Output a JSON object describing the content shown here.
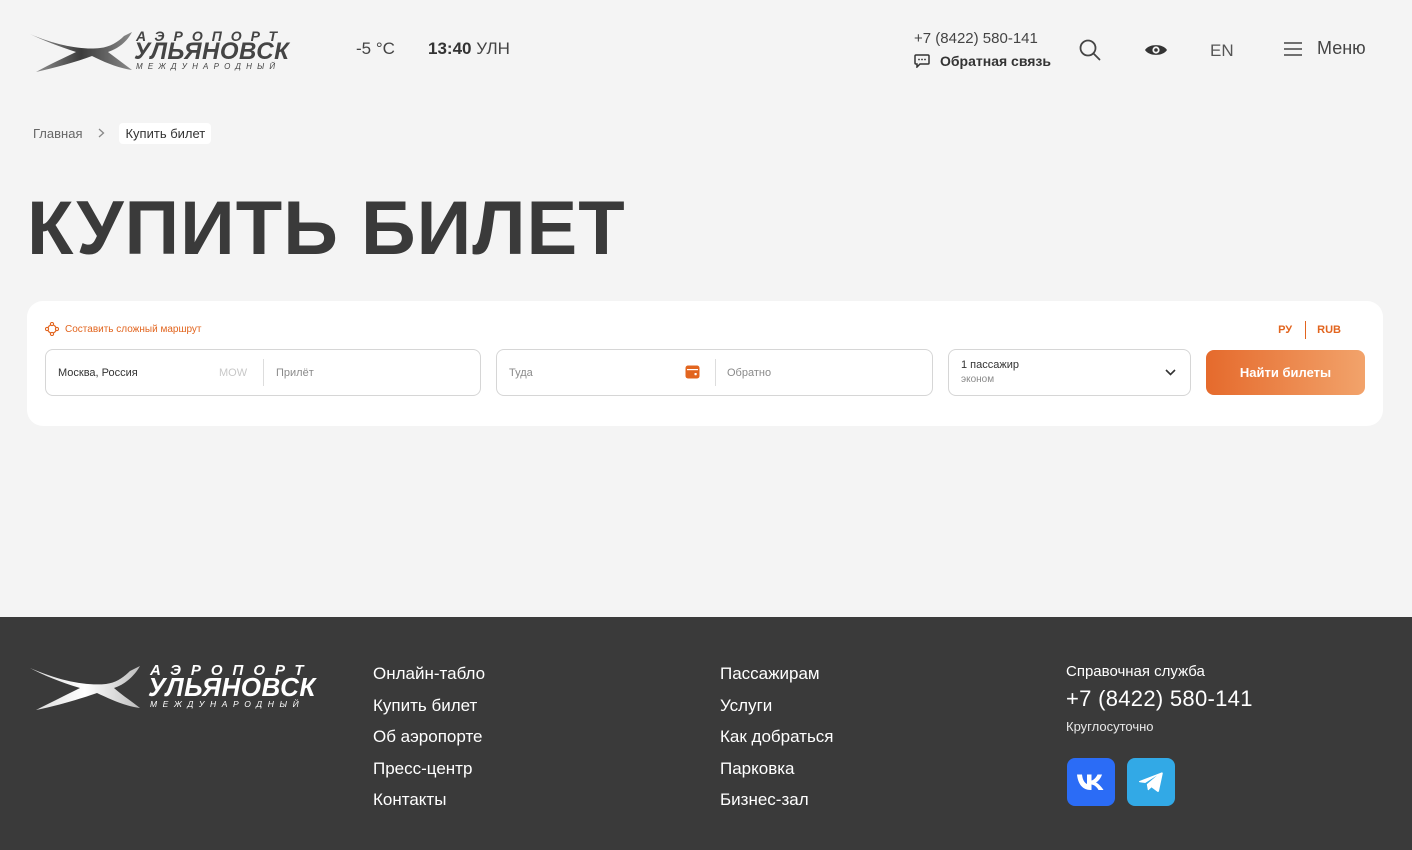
{
  "header": {
    "logo": {
      "line1": "АЭРОПОРТ",
      "line2": "УЛЬЯНОВСК",
      "line3": "МЕЖДУНАРОДНЫЙ"
    },
    "weather": "-5 °C",
    "time": "13:40",
    "timezone": "УЛН",
    "phone": "+7 (8422) 580-141",
    "feedback": "Обратная связь",
    "lang": "EN",
    "menu": "Меню",
    "icons": [
      "search-icon",
      "eye-icon",
      "hamburger-icon",
      "chat-icon"
    ]
  },
  "breadcrumb": {
    "home": "Главная",
    "current": "Купить билет"
  },
  "page_title": "КУПИТЬ БИЛЕТ",
  "search": {
    "complex_route": "Составить сложный маршрут",
    "lang": "РУ",
    "currency": "RUB",
    "from_value": "Москва, Россия",
    "from_code": "MOW",
    "to_placeholder": "Прилёт",
    "there_placeholder": "Туда",
    "back_placeholder": "Обратно",
    "passengers": "1 пассажир",
    "class": "эконом",
    "button": "Найти билеты"
  },
  "footer": {
    "col1": [
      "Онлайн-табло",
      "Купить билет",
      "Об аэропорте",
      "Пресс-центр",
      "Контакты"
    ],
    "col2": [
      "Пассажирам",
      "Услуги",
      "Как добраться",
      "Парковка",
      "Бизнес-зал"
    ],
    "help_title": "Справочная служба",
    "help_phone": "+7 (8422) 580-141",
    "help_hours": "Круглосуточно",
    "socials": [
      "vk-icon",
      "telegram-icon"
    ]
  },
  "colors": {
    "accent": "#e2651f",
    "footer_bg": "#3a3a3a",
    "bg": "#f4f4f4",
    "vk": "#2b6cf6",
    "telegram": "#32a9e6"
  }
}
